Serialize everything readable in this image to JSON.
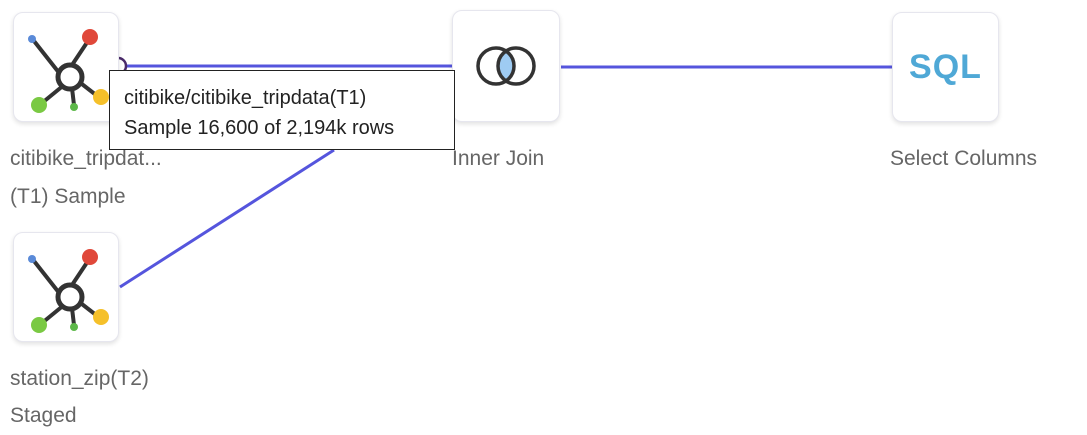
{
  "nodes": {
    "t1": {
      "label_line1": "citibike_tripdat...",
      "label_line2": "(T1) Sample",
      "icon": "dataset-hub-icon"
    },
    "join": {
      "label": "Inner Join",
      "icon": "venn-inner-join-icon"
    },
    "select": {
      "label": "Select Columns",
      "icon_text": "SQL"
    },
    "t2": {
      "label_line1": "station_zip(T2)",
      "label_line2": "Staged",
      "icon": "dataset-hub-icon"
    }
  },
  "tooltip": {
    "line1": "citibike/citibike_tripdata(T1)",
    "line2": "Sample 16,600 of 2,194k rows"
  },
  "colors": {
    "edge": "#5555dd",
    "sql": "#4fa8d6",
    "hub_red": "#e0483a",
    "hub_orange": "#f5a623",
    "hub_green": "#7ac943",
    "hub_blue": "#5a8ad8",
    "hub_dark": "#333333",
    "venn_fill": "#9ecbf2"
  }
}
